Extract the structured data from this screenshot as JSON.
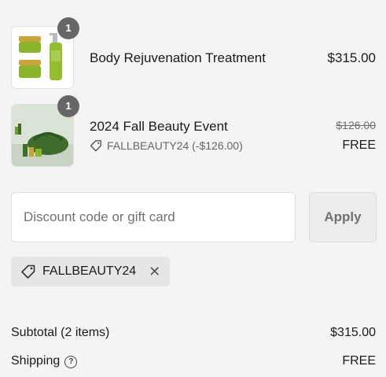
{
  "items": [
    {
      "quantity": "1",
      "name": "Body Rejuvenation Treatment",
      "price": "$315.00"
    },
    {
      "quantity": "1",
      "name": "2024 Fall Beauty Event",
      "original_price": "$126.00",
      "discount_label": "FALLBEAUTY24 (-$126.00)",
      "price": "FREE"
    }
  ],
  "discount": {
    "placeholder": "Discount code or gift card",
    "apply_label": "Apply",
    "applied_code": "FALLBEAUTY24"
  },
  "summary": {
    "subtotal_label": "Subtotal (2 items)",
    "subtotal_value": "$315.00",
    "shipping_label": "Shipping",
    "shipping_value": "FREE"
  },
  "colors": {
    "background": "#f4f4f4",
    "badge": "#666666",
    "product_green": "#7fa627"
  }
}
